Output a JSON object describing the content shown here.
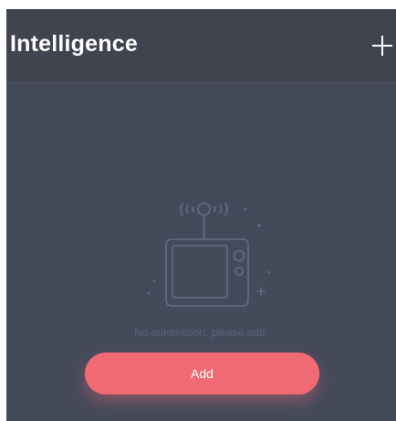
{
  "header": {
    "title": "Intelligence",
    "add_icon": "plus-icon"
  },
  "empty_state": {
    "illustration_icon": "tv-broadcast-icon",
    "message": "No automation, please add.",
    "add_label": "Add"
  },
  "colors": {
    "background": "#454a5b",
    "header_background": "#40444f",
    "accent": "#f06a73",
    "muted_text": "#59607a",
    "illustration_stroke": "#656c82"
  }
}
